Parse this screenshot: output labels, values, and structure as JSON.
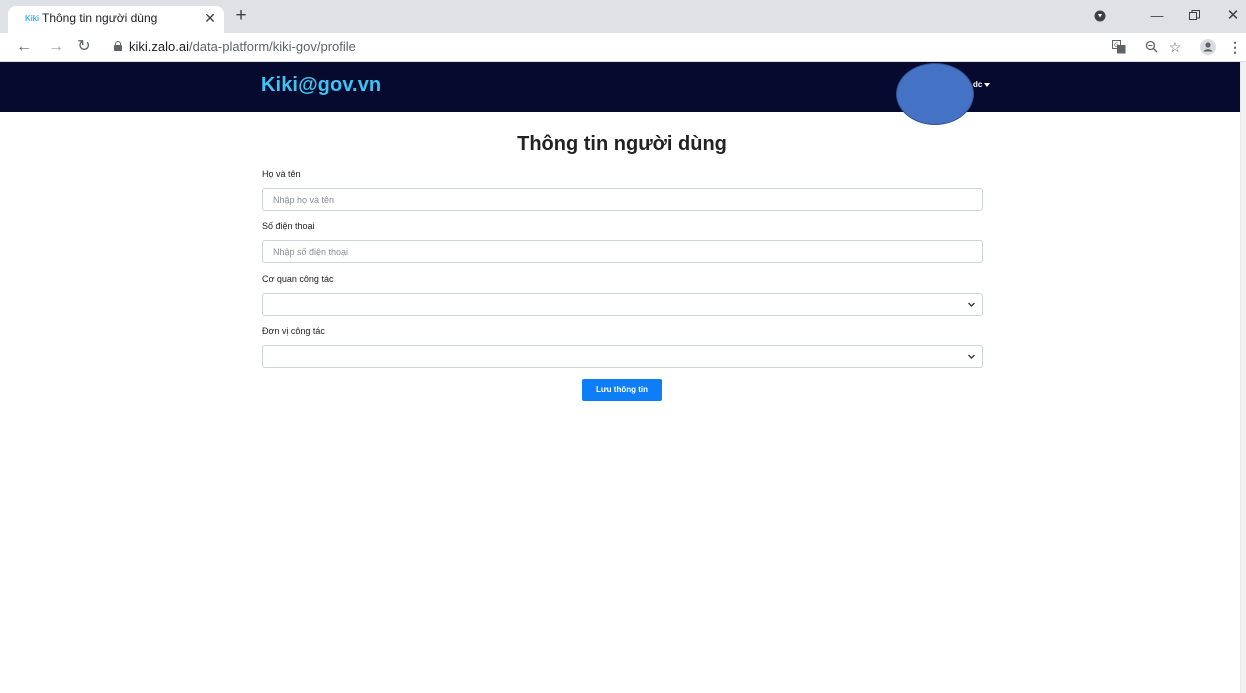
{
  "browser": {
    "tab": {
      "favicon_text": "Kiki",
      "title": "Thông tin người dùng"
    },
    "address": {
      "host": "kiki.zalo.ai",
      "path": "/data-platform/kiki-gov/profile"
    },
    "icons": [
      "arrow-left-icon",
      "arrow-right-icon",
      "reload-icon",
      "lock-icon",
      "translate-icon",
      "zoom-icon",
      "star-icon",
      "profile-icon",
      "more-vert-icon",
      "extension-icon",
      "minimize-icon",
      "restore-icon",
      "close-icon"
    ]
  },
  "header": {
    "brand": "Kiki@gov.vn",
    "user_name": "dc"
  },
  "form": {
    "title": "Thông tin người dùng",
    "fields": [
      {
        "label": "Họ và tên",
        "placeholder": "Nhập họ và tên",
        "value": ""
      },
      {
        "label": "Số điện thoại",
        "placeholder": "Nhập số điện thoại",
        "value": ""
      },
      {
        "label": "Cơ quan công tác",
        "selected": ""
      },
      {
        "label": "Đơn vị công tác",
        "selected": ""
      }
    ],
    "submit_label": "Lưu thông tin"
  },
  "colors": {
    "header_bg": "#050a2e",
    "brand": "#3ec3f4",
    "primary_button": "#0d7ef7",
    "avatar_overlay": "#4472c4"
  }
}
